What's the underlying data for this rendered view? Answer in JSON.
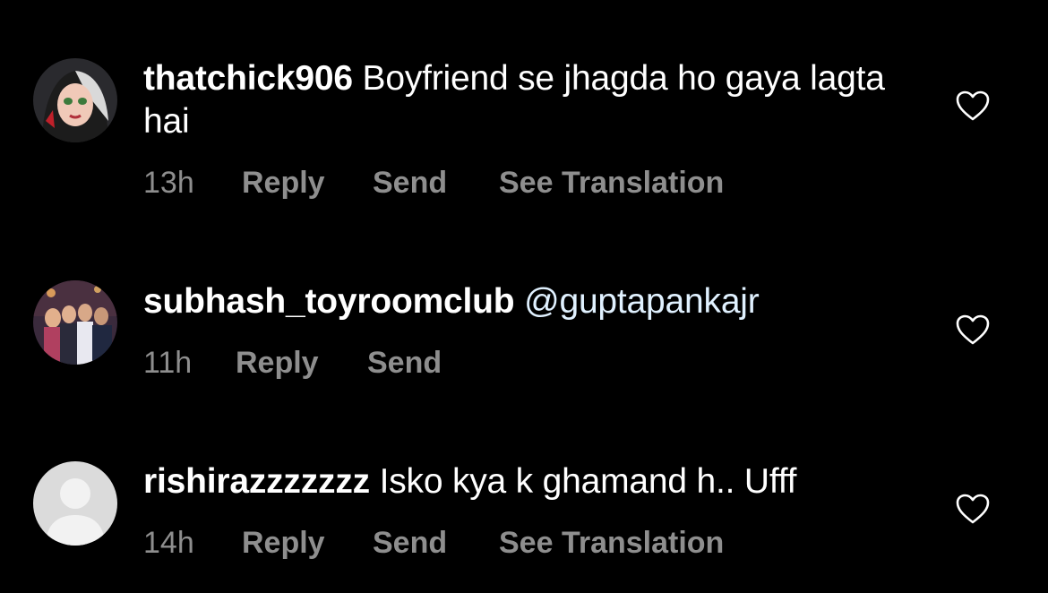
{
  "comments": [
    {
      "username": "thatchick906",
      "text": "Boyfriend se jhagda ho gaya lagta hai",
      "time": "13h",
      "reply_label": "Reply",
      "send_label": "Send",
      "translate_label": "See Translation"
    },
    {
      "username": "subhash_toyroomclub",
      "text": "@guptapankajr",
      "time": "11h",
      "reply_label": "Reply",
      "send_label": "Send"
    },
    {
      "username": "rishirazzzzzzz",
      "text": "Isko kya k ghamand h.. Ufff",
      "time": "14h",
      "reply_label": "Reply",
      "send_label": "Send",
      "translate_label": "See Translation"
    }
  ],
  "colors": {
    "background": "#000000",
    "primary_text": "#ffffff",
    "secondary_text": "#8e8e8e",
    "mention": "#e0f1ff"
  },
  "icons": {
    "like": "heart-outline-icon",
    "default_avatar": "default-avatar-icon"
  }
}
